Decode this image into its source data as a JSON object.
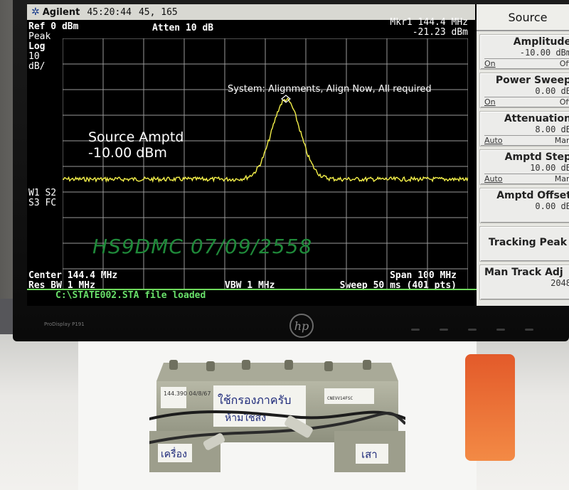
{
  "topbar": {
    "brand": "Agilent",
    "time": "45:20:44",
    "coords": "45, 165"
  },
  "plot": {
    "ref": "Ref 0 dBm",
    "atten": "Atten 10 dB",
    "marker_label": "Mkr1 144.4 MHz",
    "marker_value": "-21.23 dBm",
    "detector": "Peak",
    "scale": "Log",
    "div_value": "10",
    "div_unit": "dB/",
    "alignment_msg": "System: Alignments, Align Now, All required",
    "source_label": "Source Amptd",
    "source_value": "-10.00 dBm",
    "w1": "W1 S2",
    "s3": "S3 FC",
    "watermark": "HS9DMC 07/09/2558",
    "center": "Center 144.4 MHz",
    "span": "Span 100 MHz",
    "res_bw": "Res BW 1 MHz",
    "vbw": "VBW 1 MHz",
    "sweep": "Sweep 50 ms (401 pts)"
  },
  "status": {
    "message": "C:\\STATE002.STA file loaded"
  },
  "softkeys": {
    "title": "Source",
    "keys": [
      {
        "title": "Amplitude",
        "value": "-10.00 dBm",
        "opt_a": "On",
        "opt_b": "Off"
      },
      {
        "title": "Power Sweep",
        "value": "0.00 dB",
        "opt_a": "On",
        "opt_b": "Off"
      },
      {
        "title": "Attenuation",
        "value": "8.00 dB",
        "opt_a": "Auto",
        "opt_b": "Man"
      },
      {
        "title": "Amptd Step",
        "value": "10.00 dB",
        "opt_a": "Auto",
        "opt_b": "Man"
      },
      {
        "title": "Amptd Offset",
        "value": "0.00 dB"
      },
      {
        "title": "Tracking Peak"
      },
      {
        "title": "Man Track Adj",
        "value": "2048"
      }
    ]
  },
  "monitor": {
    "model": "ProDisplay P191",
    "logo": "hp"
  },
  "filter_labels": {
    "sticker_left": "144.390\n04/8/67",
    "handwritten_1": "ใช้กรองภาครับ",
    "handwritten_2": "ห้ามใช้ส่ง",
    "port_left": "เครื่อง",
    "port_right": "เสา",
    "barcode_text": "CNEVV14FSC"
  },
  "colors": {
    "trace": "#f4f04a",
    "grid": "#9a9a9a",
    "status": "#69e06a",
    "watermark": "#1f8a3a"
  }
}
